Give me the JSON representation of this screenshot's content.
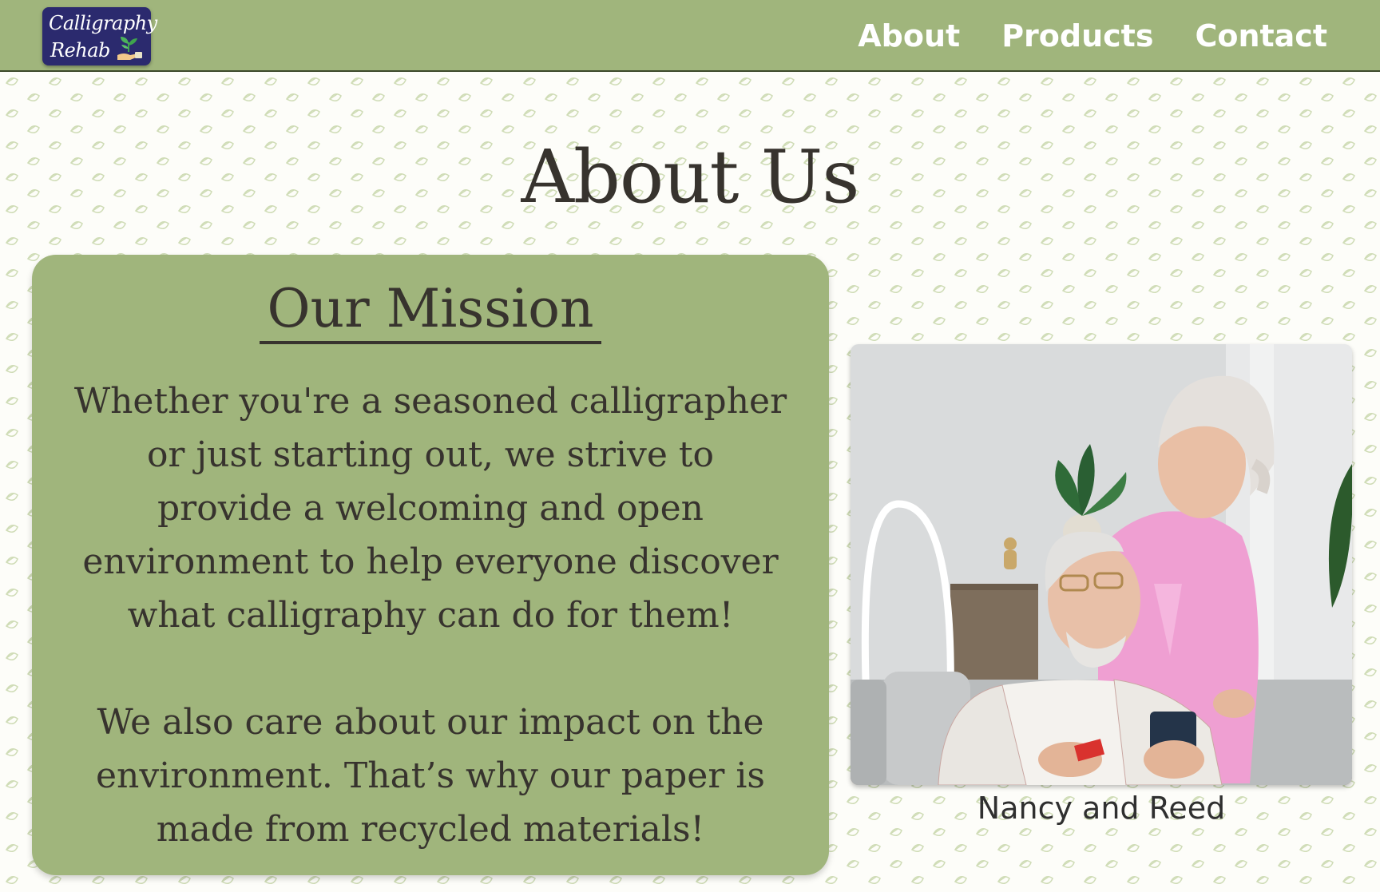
{
  "brand": {
    "logo_line1": "Calligraphy",
    "logo_line2": "Rehab",
    "logo_icon": "sprout-in-hand-icon"
  },
  "nav": {
    "items": [
      {
        "label": "About"
      },
      {
        "label": "Products"
      },
      {
        "label": "Contact"
      }
    ]
  },
  "page": {
    "title": "About Us"
  },
  "mission": {
    "heading": "Our Mission",
    "paragraph1": "Whether you're a seasoned calligrapher\nor just starting out, we strive to\nprovide a welcoming and open\nenvironment to help everyone discover\nwhat calligraphy can do for them!",
    "paragraph2": "We also care about our impact on the\nenvironment. That’s why our paper is\nmade from recycled materials!"
  },
  "photo": {
    "caption": "Nancy and Reed"
  },
  "colors": {
    "nav_green": "#a0b57c",
    "logo_navy": "#2b2a6e",
    "text_dark": "#37332e",
    "leaf_pattern": "#cfdcb6"
  }
}
